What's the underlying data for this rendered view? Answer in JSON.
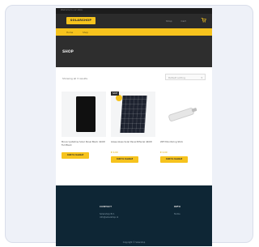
{
  "topbar": {
    "text": "Welcome to our store"
  },
  "header": {
    "logo": "SOLARSHOP",
    "nav": [
      "Shop",
      "Cart"
    ]
  },
  "breadcrumb": [
    "Home",
    "Shop"
  ],
  "page": {
    "title": "SHOP"
  },
  "toolbar": {
    "results": "Showing all 3 results",
    "sort": "Default sorting"
  },
  "products": [
    {
      "badge": "",
      "name": "Monocrystalline Solar Panel Black 410W Full Black",
      "price": "",
      "button": "Add to basket"
    },
    {
      "badge": "SALE",
      "name": "Glass-Glass Solar Panel Bifacial 440W",
      "price": "€ 0,00",
      "button": "Add to basket"
    },
    {
      "badge": "",
      "name": "WiFi Monitoring Stick",
      "price": "€ 0,00",
      "button": "Add to basket"
    }
  ],
  "footer": {
    "col1_title": "CONTACT",
    "col1_lines": [
      "Solarshop B.V.",
      "info@solarshop.nl"
    ],
    "col2_title": "INFO",
    "col2_lines": [
      "Terms"
    ],
    "bottom": "Copyright © Solarshop"
  },
  "colors": {
    "accent": "#f6c31d",
    "header": "#2b2b2b",
    "footer": "#0e2635"
  }
}
